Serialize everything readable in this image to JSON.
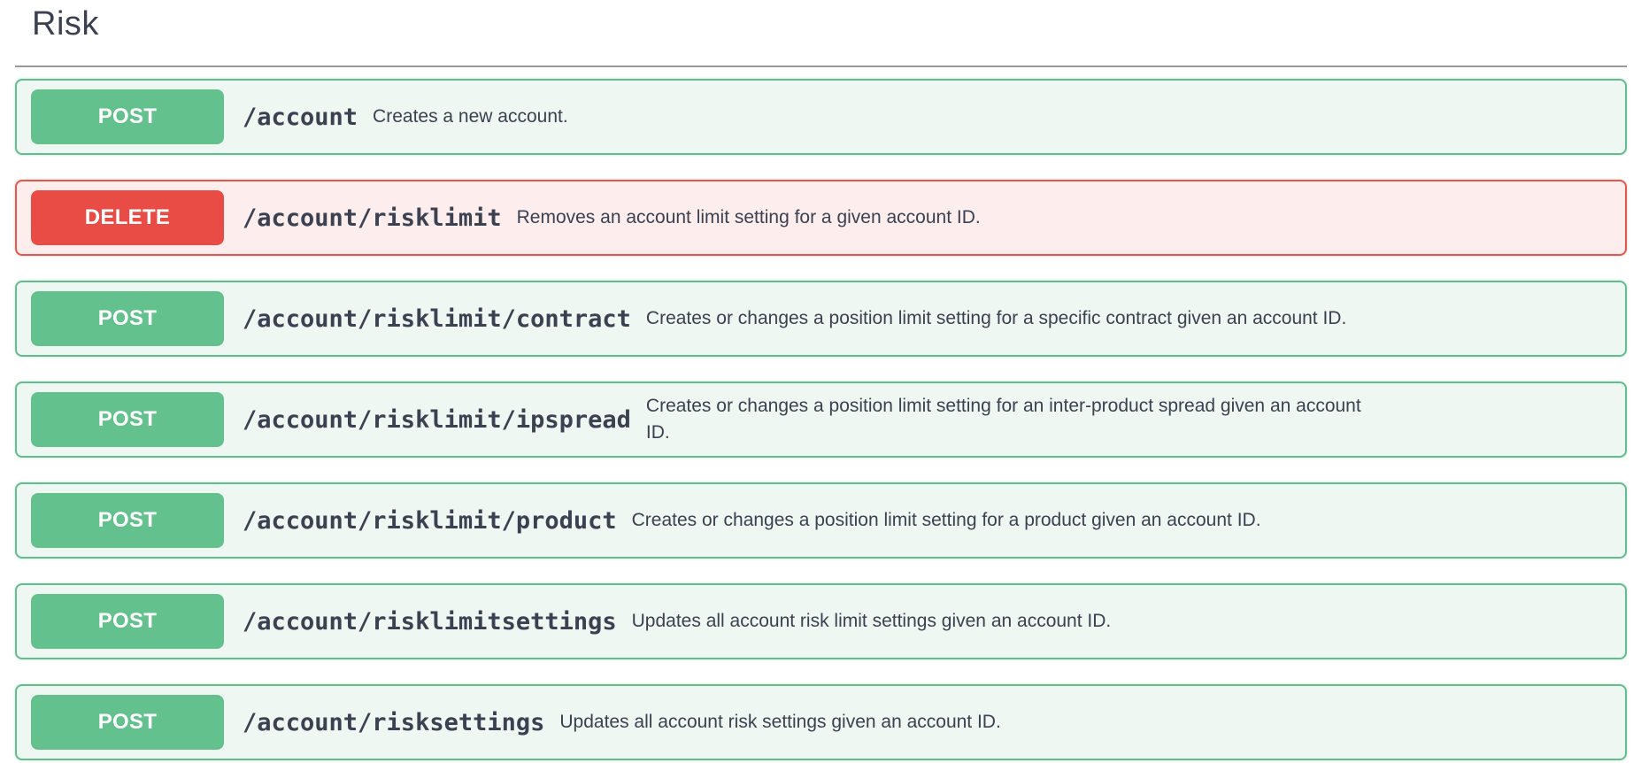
{
  "page": {
    "heading": "Risk"
  },
  "colors": {
    "post_badge": "#62c18d",
    "post_border": "#5fbf8e",
    "post_row_bg": "#eef7f2",
    "delete_badge": "#e84c44",
    "delete_border": "#e8564b",
    "delete_row_bg": "#fdeded",
    "text": "#3b4151"
  },
  "endpoints": [
    {
      "method": "POST",
      "path": "/account",
      "description": "Creates a new account."
    },
    {
      "method": "DELETE",
      "path": "/account/risklimit",
      "description": "Removes an account limit setting for a given account ID."
    },
    {
      "method": "POST",
      "path": "/account/risklimit/contract",
      "description": "Creates or changes a position limit setting for a specific contract given an account ID."
    },
    {
      "method": "POST",
      "path": "/account/risklimit/ipspread",
      "description": "Creates or changes a position limit setting for an inter-product spread given an account ID."
    },
    {
      "method": "POST",
      "path": "/account/risklimit/product",
      "description": "Creates or changes a position limit setting for a product given an account ID."
    },
    {
      "method": "POST",
      "path": "/account/risklimitsettings",
      "description": "Updates all account risk limit settings given an account ID."
    },
    {
      "method": "POST",
      "path": "/account/risksettings",
      "description": "Updates all account risk settings given an account ID."
    }
  ]
}
